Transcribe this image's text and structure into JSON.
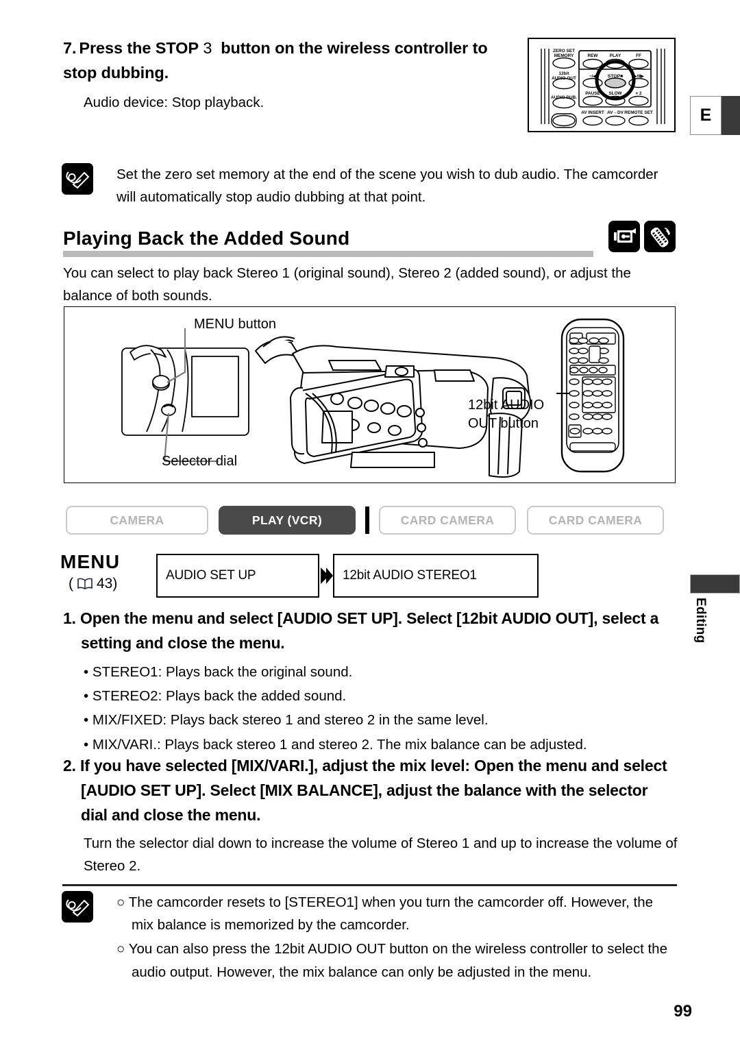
{
  "page": {
    "number": "99",
    "side_tab_label": "Editing",
    "corner_tab_letter": "E"
  },
  "step7": {
    "number": "7.",
    "title_part1": "Press the STOP",
    "title_symbol": "3",
    "title_part2": "button on the wireless controller to stop dubbing.",
    "subtext": "Audio device: Stop playback."
  },
  "memo_top": {
    "icon": "memo-pencil-icon",
    "text": "Set the zero set memory at the end of the scene you wish to dub audio. The camcorder will automatically stop audio dubbing at that point."
  },
  "section": {
    "title": "Playing Back the Added Sound",
    "icons": [
      "camcorder-tape-icon",
      "wireless-controller-icon"
    ],
    "intro": "You can select to play back Stereo 1 (original sound), Stereo 2 (added sound), or adjust the balance of both sounds."
  },
  "illustration": {
    "labels": {
      "menu_button": "MENU button",
      "selector_dial": "Selector dial",
      "audio_out_line1": "12bit AUDIO",
      "audio_out_line2": "OUT button"
    }
  },
  "remote_detail": {
    "left_buttons": [
      "ZERO SET MEMORY",
      "12bit AUDIO OUT",
      "AUDIO DUB."
    ],
    "row1": [
      "REW",
      "PLAY",
      "FF"
    ],
    "row2": [
      "−/◀",
      "STOP",
      "▶/II▶"
    ],
    "row3": [
      "PAUSE",
      "SLOW",
      "× 2"
    ],
    "row4": [
      "AV INSERT",
      "AV→DV",
      "REMOTE SET"
    ],
    "highlighted": "STOP"
  },
  "modes": [
    {
      "label": "CAMERA",
      "active": false
    },
    {
      "label": "PLAY (VCR)",
      "active": true
    },
    {
      "label": "CARD CAMERA",
      "active": false
    },
    {
      "label": "CARD CAMERA",
      "active": false
    }
  ],
  "menu_row": {
    "word": "MENU",
    "ref_open": "(",
    "ref_page": "43)",
    "box1": "AUDIO SET UP",
    "box2": "12bit AUDIO   STEREO1"
  },
  "steps": [
    {
      "number": "1.",
      "title": "Open the menu and select [AUDIO SET UP]. Select [12bit AUDIO OUT], select a setting and close the menu.",
      "bullets": [
        "• STEREO1: Plays back the original sound.",
        "• STEREO2: Plays back the added sound.",
        "• MIX/FIXED: Plays back stereo 1 and stereo 2 in the same level.",
        "• MIX/VARI.: Plays back stereo 1 and stereo 2. The mix balance can be adjusted."
      ]
    },
    {
      "number": "2.",
      "title": "If you have selected [MIX/VARI.], adjust the mix level: Open the menu and select [AUDIO SET UP]. Select [MIX BALANCE], adjust the balance with the selector dial and close the menu.",
      "note": "Turn the selector dial down to increase the volume of Stereo 1 and up to increase the volume of Stereo 2."
    }
  ],
  "memo_bottom": {
    "icon": "memo-pencil-icon",
    "notes": [
      "○ The camcorder resets to [STEREO1] when you turn the camcorder off. However, the mix balance is memorized by the camcorder.",
      "○ You can also press the 12bit AUDIO OUT button on the wireless controller to select the audio output. However, the mix balance can only be adjusted in the menu."
    ]
  },
  "colors": {
    "rule": "#b9b9b9",
    "active_tab": "#4a4a4a",
    "inactive_tab_text": "#b4b4b4",
    "dark_tab": "#3a3a3a"
  }
}
